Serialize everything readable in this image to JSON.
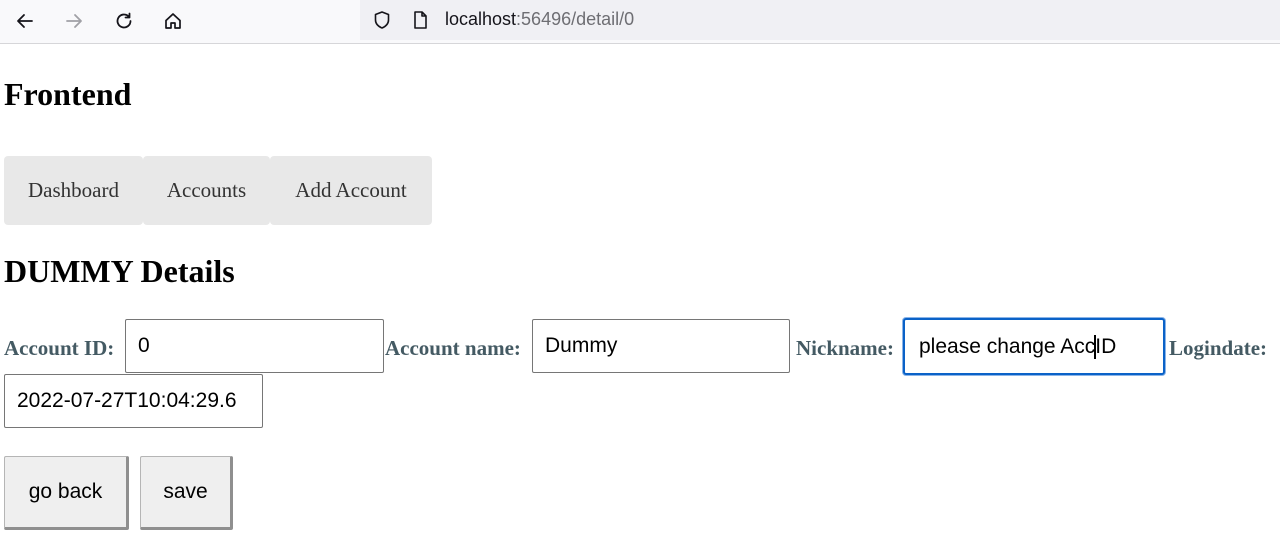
{
  "browser": {
    "url_host": "localhost",
    "url_path": ":56496/detail/0",
    "icons": [
      "back-arrow-icon",
      "forward-arrow-icon",
      "reload-icon",
      "home-icon",
      "shield-icon",
      "page-icon"
    ]
  },
  "app": {
    "title": "Frontend",
    "nav": [
      {
        "label": "Dashboard"
      },
      {
        "label": "Accounts"
      },
      {
        "label": "Add Account"
      }
    ]
  },
  "detail": {
    "heading": "DUMMY Details",
    "account_id_label": "Account ID:",
    "account_id_value": "0",
    "account_name_label": "Account name:",
    "account_name_value": "Dummy",
    "nickname_label": "Nickname:",
    "nickname_value_before_caret": "please change Acc",
    "nickname_value_after_caret": "ID",
    "logindate_label": "Logindate:",
    "logindate_value": "2022-07-27T10:04:29.6"
  },
  "actions": {
    "back_label": "go back",
    "save_label": "save"
  },
  "colors": {
    "label": "#445a63",
    "focus": "#0a62c8",
    "nav_bg": "#e8e8e8"
  }
}
